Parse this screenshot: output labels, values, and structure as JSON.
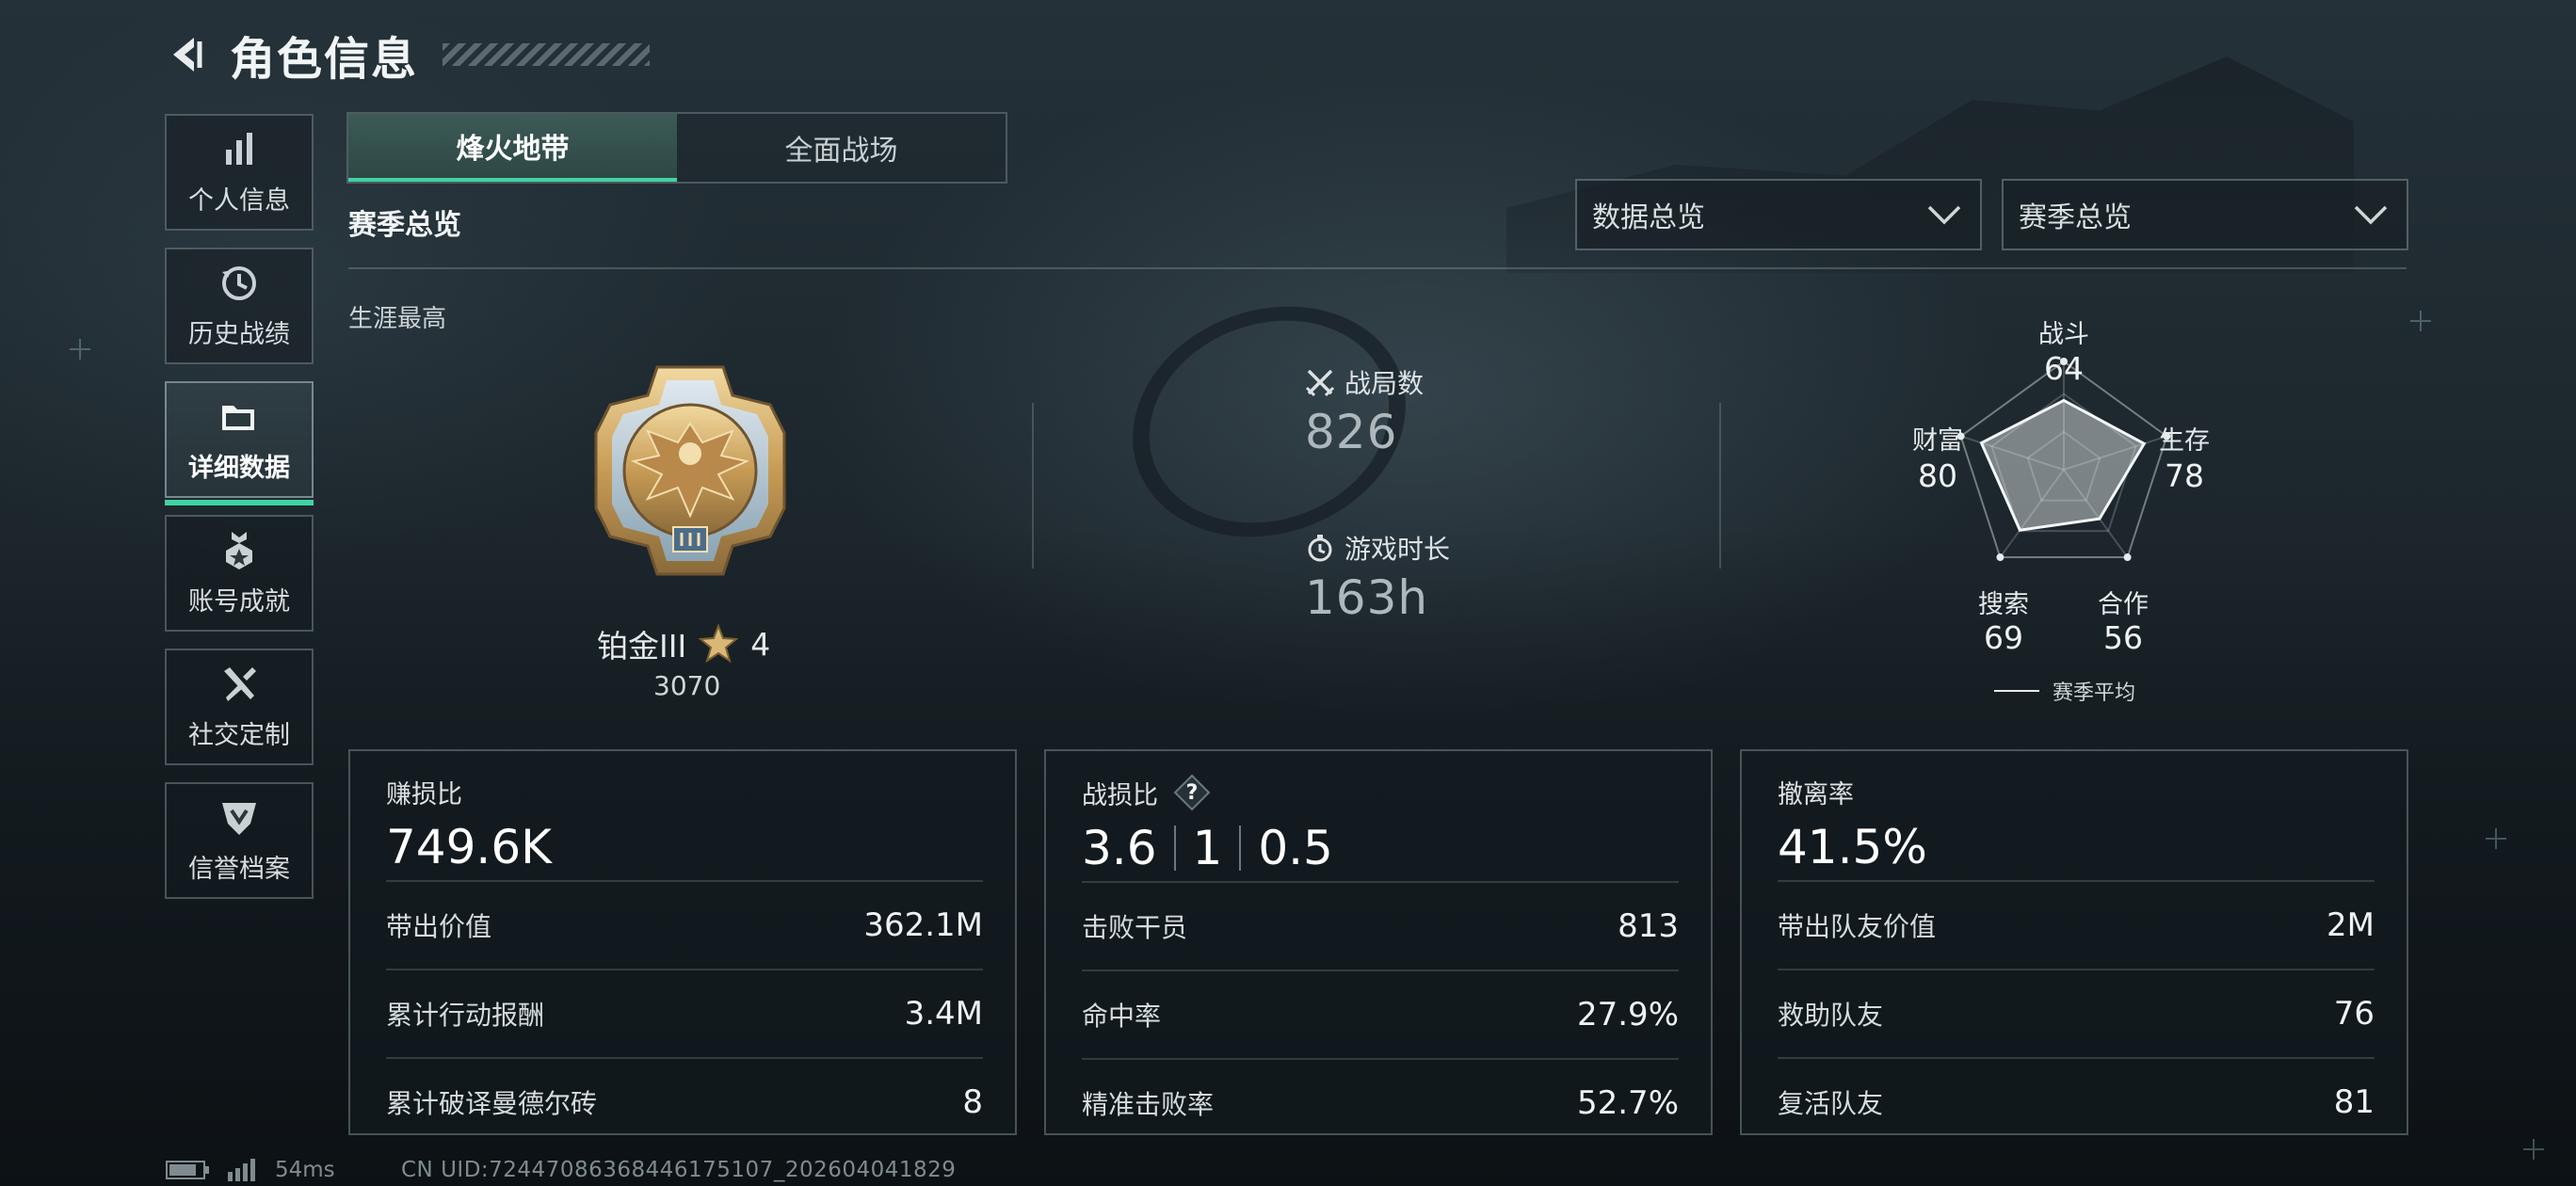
{
  "header": {
    "title": "角色信息"
  },
  "nav": {
    "items": [
      {
        "label": "个人信息",
        "icon": "bar-chart-icon"
      },
      {
        "label": "历史战绩",
        "icon": "history-icon"
      },
      {
        "label": "详细数据",
        "icon": "folder-icon",
        "active": true
      },
      {
        "label": "账号成就",
        "icon": "medal-icon"
      },
      {
        "label": "社交定制",
        "icon": "tools-icon"
      },
      {
        "label": "信誉档案",
        "icon": "shield-icon"
      }
    ]
  },
  "tabs": [
    {
      "label": "烽火地带",
      "active": true
    },
    {
      "label": "全面战场",
      "active": false
    }
  ],
  "section": {
    "title": "赛季总览",
    "career_label": "生涯最高"
  },
  "filters": {
    "data_select": "数据总览",
    "season_select": "赛季总览"
  },
  "rank": {
    "name": "铂金III",
    "stars": "4",
    "score": "3070",
    "medal": "platinum-eagle-medal-icon"
  },
  "stats": {
    "matches": {
      "label": "战局数",
      "value": "826"
    },
    "playtime": {
      "label": "游戏时长",
      "value": "163h"
    }
  },
  "radar": {
    "axes": [
      {
        "label": "战斗",
        "value": 64
      },
      {
        "label": "生存",
        "value": 78
      },
      {
        "label": "合作",
        "value": 56
      },
      {
        "label": "搜索",
        "value": 69
      },
      {
        "label": "财富",
        "value": 80
      }
    ],
    "legend": "赛季平均"
  },
  "cards": [
    {
      "title": "赚损比",
      "main": "749.6K",
      "rows": [
        {
          "k": "带出价值",
          "v": "362.1M"
        },
        {
          "k": "累计行动报酬",
          "v": "3.4M"
        },
        {
          "k": "累计破译曼德尔砖",
          "v": "8"
        }
      ]
    },
    {
      "title": "战损比",
      "main_parts": [
        "3.6",
        "1",
        "0.5"
      ],
      "help_icon": "?",
      "rows": [
        {
          "k": "击败干员",
          "v": "813"
        },
        {
          "k": "命中率",
          "v": "27.9%"
        },
        {
          "k": "精准击败率",
          "v": "52.7%"
        }
      ]
    },
    {
      "title": "撤离率",
      "main": "41.5%",
      "rows": [
        {
          "k": "带出队友价值",
          "v": "2M"
        },
        {
          "k": "救助队友",
          "v": "76"
        },
        {
          "k": "复活队友",
          "v": "81"
        }
      ]
    }
  ],
  "footer": {
    "ping": "54ms",
    "uid": "CN UID:72447086368446175107_202604041829"
  }
}
